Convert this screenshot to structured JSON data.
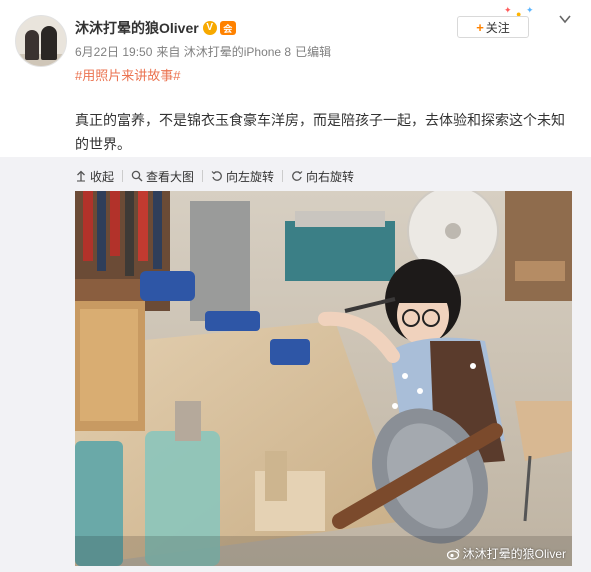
{
  "post": {
    "author": "沐沐打晕的狼Oliver",
    "verified_badge": "V",
    "vip_badge": "会",
    "date": "6月22日 19:50",
    "source": "来自 沐沐打晕的iPhone 8",
    "edited": "已编辑",
    "follow_label": "关注",
    "topic": "#用照片来讲故事#",
    "text": "真正的富养，不是锦衣玉食豪车洋房，而是陪孩子一起，去体验和探索这个未知的世界。"
  },
  "toolbar": {
    "collapse": "收起",
    "view_large": "查看大图",
    "rotate_left": "向左旋转",
    "rotate_right": "向右旋转"
  },
  "photo": {
    "watermark": "沐沐打晕的狼Oliver"
  },
  "colors": {
    "topic": "#eb7350",
    "accent_orange": "#ff8200",
    "verified_gold": "#f7a900",
    "panel_bg": "#f2f2f5"
  },
  "icons": [
    "avatar",
    "verified-icon",
    "vip-icon",
    "chevron-down-icon",
    "collapse-arrow-icon",
    "search-icon",
    "rotate-left-icon",
    "rotate-right-icon",
    "weibo-logo-icon"
  ]
}
